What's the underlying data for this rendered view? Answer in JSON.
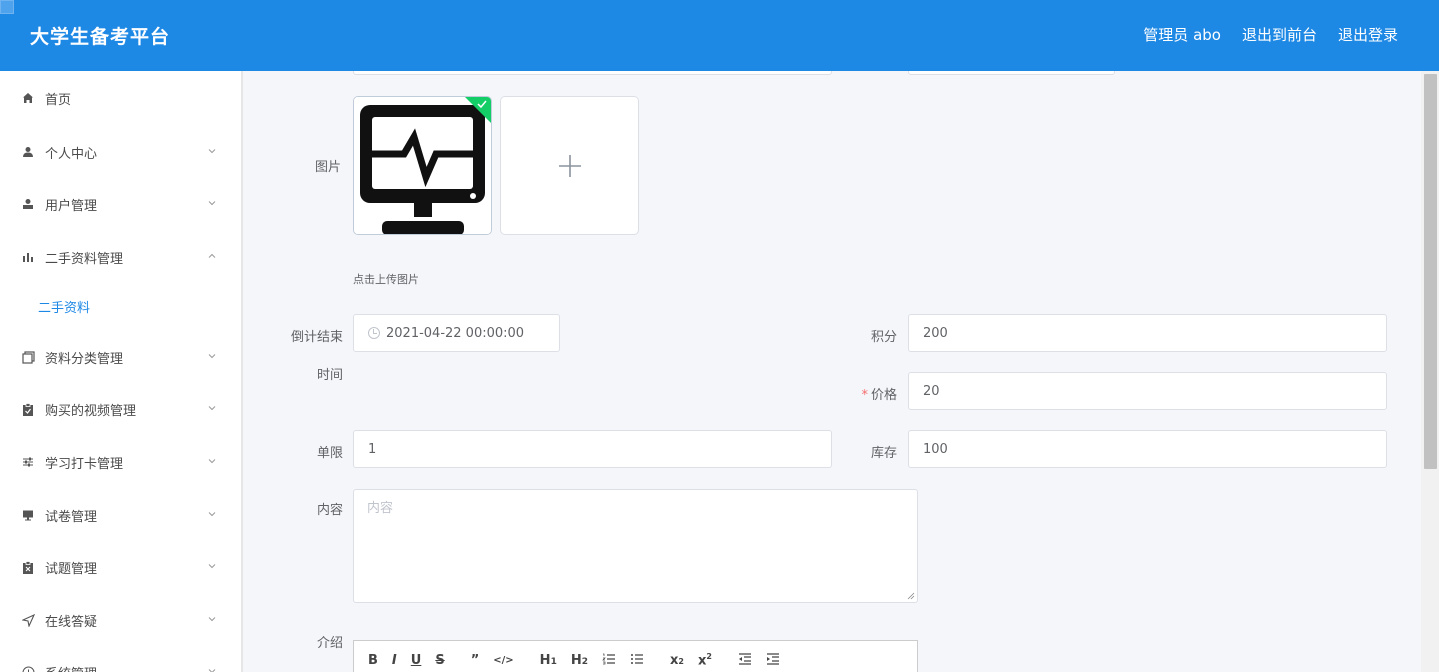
{
  "header": {
    "title": "大学生备考平台",
    "admin_label": "管理员 abo",
    "back_to_front": "退出到前台",
    "logout": "退出登录"
  },
  "sidebar": {
    "items": [
      {
        "label": "首页",
        "icon": "home-icon"
      },
      {
        "label": "个人中心",
        "icon": "user-icon",
        "expanded": false
      },
      {
        "label": "用户管理",
        "icon": "user-manage-icon",
        "expanded": false
      },
      {
        "label": "二手资料管理",
        "icon": "bar-chart-icon",
        "expanded": true
      },
      {
        "label": "二手资料",
        "sub": true,
        "active": true
      },
      {
        "label": "资料分类管理",
        "icon": "copy-icon",
        "expanded": false
      },
      {
        "label": "购买的视频管理",
        "icon": "clipboard-icon",
        "expanded": false
      },
      {
        "label": "学习打卡管理",
        "icon": "sliders-icon",
        "expanded": false
      },
      {
        "label": "试卷管理",
        "icon": "monitor-icon",
        "expanded": false
      },
      {
        "label": "试题管理",
        "icon": "clipboard-check-icon",
        "expanded": false
      },
      {
        "label": "在线答疑",
        "icon": "send-icon",
        "expanded": false
      },
      {
        "label": "系统管理",
        "icon": "clock-icon",
        "expanded": false
      }
    ]
  },
  "form": {
    "image_label": "图片",
    "upload_hint": "点击上传图片",
    "countdown_label_line1": "倒计结束",
    "countdown_label_line2": "时间",
    "countdown_value": "2021-04-22 00:00:00",
    "points_label": "积分",
    "points_value": "200",
    "price_label": "价格",
    "price_value": "20",
    "limit_label": "单限",
    "limit_value": "1",
    "stock_label": "库存",
    "stock_value": "100",
    "content_label": "内容",
    "content_placeholder": "内容",
    "intro_label": "介绍"
  },
  "editor_toolbar": [
    "B",
    "I",
    "U",
    "S",
    "99",
    "</>",
    "H1",
    "H2",
    "ol",
    "ul",
    "x2-sub",
    "x2-sup",
    "outdent",
    "indent"
  ],
  "colors": {
    "header_bg": "#1e88e5",
    "active_submenu": "#1e88e5",
    "required": "#f56c6c",
    "success_badge": "#13ce66"
  }
}
